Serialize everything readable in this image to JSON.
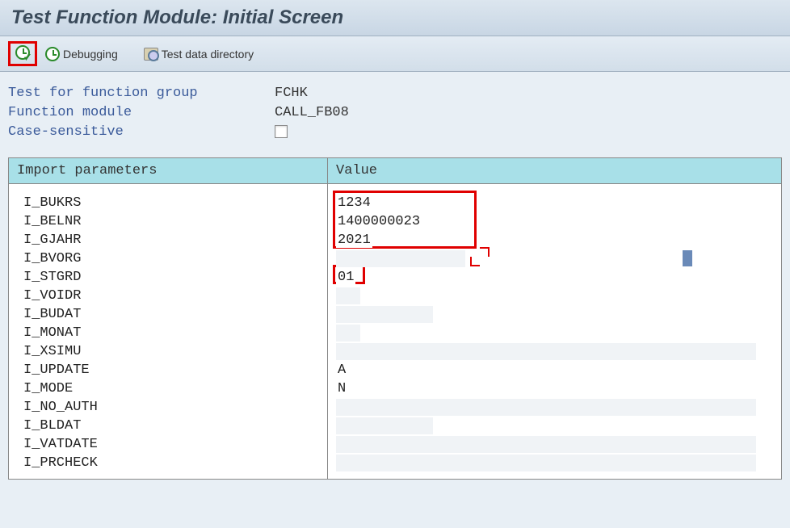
{
  "title": "Test Function Module: Initial Screen",
  "toolbar": {
    "execute": "",
    "debugging": "Debugging",
    "test_dir": "Test data directory"
  },
  "info": {
    "group_label": "Test for function group",
    "group_value": "FCHK",
    "module_label": "Function module",
    "module_value": "CALL_FB08",
    "case_label": "Case-sensitive"
  },
  "table": {
    "head_name": "Import parameters",
    "head_value": "Value",
    "rows": [
      {
        "name": "I_BUKRS",
        "value": "1234",
        "shadeW": 0
      },
      {
        "name": "I_BELNR",
        "value": "1400000023",
        "shadeW": 0
      },
      {
        "name": "I_GJAHR",
        "value": "2021",
        "shadeW": 0
      },
      {
        "name": "I_BVORG",
        "value": "",
        "shadeW": 160
      },
      {
        "name": "I_STGRD",
        "value": "01",
        "shadeW": 0
      },
      {
        "name": "I_VOIDR",
        "value": "",
        "shadeW": 30
      },
      {
        "name": "I_BUDAT",
        "value": "",
        "shadeW": 120
      },
      {
        "name": "I_MONAT",
        "value": "",
        "shadeW": 30
      },
      {
        "name": "I_XSIMU",
        "value": "",
        "shadeW": 520
      },
      {
        "name": "I_UPDATE",
        "value": "A",
        "shadeW": 0
      },
      {
        "name": "I_MODE",
        "value": "N",
        "shadeW": 0
      },
      {
        "name": "I_NO_AUTH",
        "value": "",
        "shadeW": 520
      },
      {
        "name": "I_BLDAT",
        "value": "",
        "shadeW": 120
      },
      {
        "name": "I_VATDATE",
        "value": "",
        "shadeW": 520
      },
      {
        "name": "I_PRCHECK",
        "value": "",
        "shadeW": 520
      }
    ]
  }
}
